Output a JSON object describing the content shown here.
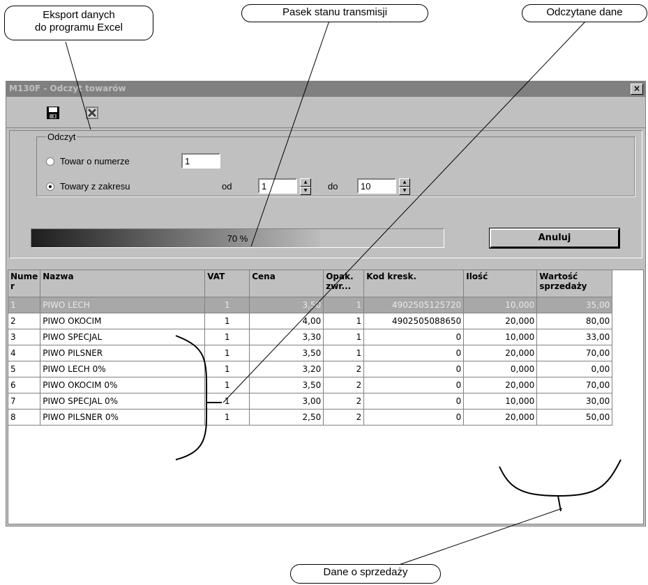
{
  "callouts": {
    "export": "Eksport danych\ndo programu Excel",
    "status": "Pasek stanu transmisji",
    "data": "Odczytane dane",
    "sales": "Dane o sprzedaży"
  },
  "window": {
    "title": "M130F - Odczyt towarów",
    "close": "×"
  },
  "toolbar": {
    "icons": [
      "save-icon",
      "excel-export-icon"
    ]
  },
  "read_group": {
    "legend": "Odczyt",
    "option_single": "Towar o numerze",
    "single_value": "1",
    "option_range": "Towary z zakresu",
    "selected": "Towary z zakresu",
    "from_label": "od",
    "from_value": "1",
    "to_label": "do",
    "to_value": "10"
  },
  "progress": {
    "value": 0.7,
    "label": "70 %"
  },
  "cancel_label": "Anuluj",
  "table": {
    "columns": [
      "Nume r",
      "Nazwa",
      "VAT",
      "Cena",
      "Opak. zwr...",
      "Kod kresk.",
      "Ilość",
      "Wartość sprzedaży"
    ],
    "rows": [
      [
        "1",
        "PIWO LECH",
        "1",
        "3,50",
        "1",
        "4902505125720",
        "10,000",
        "35,00"
      ],
      [
        "2",
        "PIWO OKOCIM",
        "1",
        "4,00",
        "1",
        "4902505088650",
        "20,000",
        "80,00"
      ],
      [
        "3",
        "PIWO SPECJAL",
        "1",
        "3,30",
        "1",
        "0",
        "10,000",
        "33,00"
      ],
      [
        "4",
        "PIWO PILSNER",
        "1",
        "3,50",
        "1",
        "0",
        "20,000",
        "70,00"
      ],
      [
        "5",
        "PIWO LECH 0%",
        "1",
        "3,20",
        "2",
        "0",
        "0,000",
        "0,00"
      ],
      [
        "6",
        "PIWO OKOCIM 0%",
        "1",
        "3,50",
        "2",
        "0",
        "20,000",
        "70,00"
      ],
      [
        "7",
        "PIWO SPECJAL 0%",
        "1",
        "3,00",
        "2",
        "0",
        "10,000",
        "30,00"
      ],
      [
        "8",
        "PIWO PILSNER 0%",
        "1",
        "2,50",
        "2",
        "0",
        "20,000",
        "50,00"
      ]
    ],
    "selected_row": 0
  }
}
